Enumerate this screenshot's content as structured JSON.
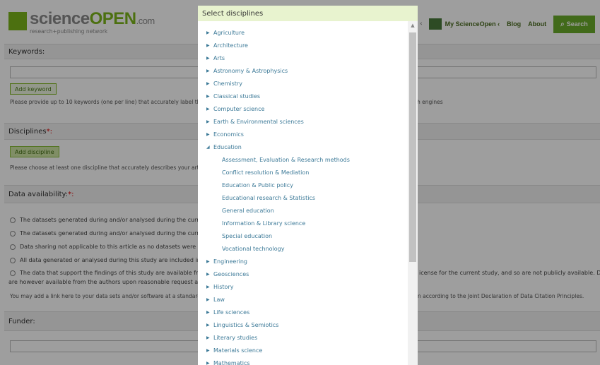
{
  "logo": {
    "name_part1": "science",
    "name_part2": "OPEN",
    "name_part3": ".com",
    "tagline": "research+publishing network"
  },
  "nav": {
    "chevron": "‹",
    "my_scienceopen": "My ScienceOpen ‹",
    "blog": "Blog",
    "about": "About",
    "search_label": "Search",
    "search_icon": "⌕",
    "settings_icon": "⚙"
  },
  "form": {
    "keywords": {
      "heading": "Keywords:",
      "add_button": "Add keyword",
      "help_left": "Please provide up to 10 keywords (one per line) that accurately label the",
      "help_right": "h engines"
    },
    "disciplines": {
      "heading": "Disciplines",
      "required_mark": "*:",
      "add_button": "Add discipline",
      "help": "Please choose at least one discipline that accurately describes your article"
    },
    "data_availability": {
      "heading": "Data availability:",
      "required_mark": "*:",
      "options": [
        "The datasets generated during and/or analysed during the curre",
        "The datasets generated during and/or analysed during the curre",
        "Data sharing not applicable to this article as no datasets were ge",
        "All data generated or analysed during this study are included in",
        "The data that support the findings of this study are available fro"
      ],
      "option5_right": "icense for the current study, and so are not publicly available. Data",
      "option5_line2": "are however available from the authors upon reasonable request an",
      "link_help_left": "You may add a link here to your data sets and/or software at a standard",
      "link_help_right": "n according to the Joint Declaration of Data Citation Principles."
    },
    "funder": {
      "heading": "Funder:"
    }
  },
  "modal": {
    "title": "Select disciplines",
    "close_label": "×",
    "scroll_up": "▲",
    "collapsed_marker": "▶",
    "expanded_marker": "◢",
    "items_before": [
      "Agriculture",
      "Architecture",
      "Arts",
      "Astronomy & Astrophysics",
      "Chemistry",
      "Classical studies",
      "Computer science",
      "Earth & Environmental sciences",
      "Economics"
    ],
    "expanded_item": "Education",
    "sub_items": [
      "Assessment, Evaluation & Research methods",
      "Conflict resolution & Mediation",
      "Education & Public policy",
      "Educational research & Statistics",
      "General education",
      "Information & Library science",
      "Special education",
      "Vocational technology"
    ],
    "items_after": [
      "Engineering",
      "Geosciences",
      "History",
      "Law",
      "Life sciences",
      "Linguistics & Semiotics",
      "Literary studies",
      "Materials science",
      "Mathematics"
    ]
  }
}
